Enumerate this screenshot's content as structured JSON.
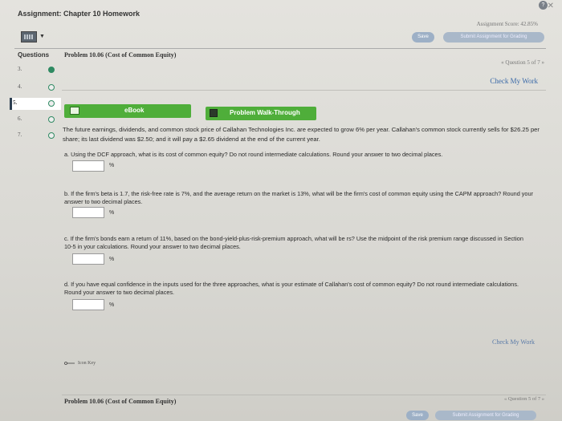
{
  "header": {
    "title": "Assignment: Chapter 10 Homework",
    "score": "Assignment Score: 42.85%",
    "save_label": "Save",
    "submit_label": "Submit Assignment for Grading"
  },
  "sidebar": {
    "heading": "Questions",
    "items": [
      {
        "num": "3."
      },
      {
        "num": "4."
      },
      {
        "num": "5."
      },
      {
        "num": "6."
      },
      {
        "num": "7."
      }
    ]
  },
  "problem": {
    "title": "Problem 10.06 (Cost of Common Equity)",
    "nav": "« Question 5 of 7 »",
    "check_label": "Check My Work",
    "ebook_label": "eBook",
    "walk_label": "Problem Walk-Through",
    "intro": "The future earnings, dividends, and common stock price of Callahan Technologies Inc. are expected to grow 6% per year. Callahan's common stock currently sells for $26.25 per share; its last dividend was $2.50; and it will pay a $2.65 dividend at the end of the current year.",
    "parts": [
      {
        "text": "a.  Using the DCF approach, what is its cost of common equity? Do not round intermediate calculations. Round your answer to two decimal places.",
        "unit": "%"
      },
      {
        "text": "b.  If the firm's beta is 1.7, the risk-free rate is 7%, and the average return on the market is 13%, what will be the firm's cost of common equity using the CAPM approach? Round your answer to two decimal places.",
        "unit": "%"
      },
      {
        "text": "c.  If the firm's bonds earn a return of 11%, based on the bond-yield-plus-risk-premium approach, what will be rs? Use the midpoint of the risk premium range discussed in Section 10-5 in your calculations. Round your answer to two decimal places.",
        "unit": "%"
      },
      {
        "text": "d.  If you have equal confidence in the inputs used for the three approaches, what is your estimate of Callahan's cost of common equity? Do not round intermediate calculations. Round your answer to two decimal places.",
        "unit": "%"
      }
    ],
    "check_label_bottom": "Check My Work",
    "icon_key": "Icon Key"
  },
  "footer": {
    "title": "Problem 10.06 (Cost of Common Equity)",
    "nav": "« Question 5 of 7 »",
    "save_label": "Save",
    "submit_label": "Submit Assignment for Grading"
  }
}
